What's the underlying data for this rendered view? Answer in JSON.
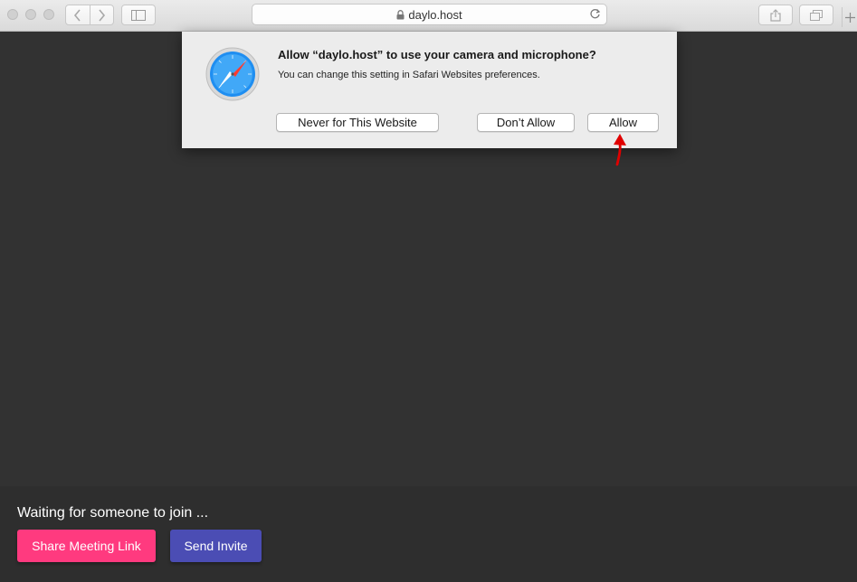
{
  "browser": {
    "address": "daylo.host",
    "icons": [
      "back-icon",
      "forward-icon",
      "sidebar-icon",
      "lock-icon",
      "reload-icon",
      "share-icon",
      "tabs-icon",
      "new-tab-icon"
    ]
  },
  "dialog": {
    "title": "Allow “daylo.host” to use your camera and microphone?",
    "subtitle": "You can change this setting in Safari Websites preferences.",
    "buttons": {
      "never": "Never for This Website",
      "dont_allow": "Don’t Allow",
      "allow": "Allow"
    },
    "icon": "safari-compass-icon"
  },
  "meeting": {
    "status": "Waiting for someone to join ...",
    "share_label": "Share Meeting Link",
    "invite_label": "Send Invite"
  },
  "colors": {
    "background": "#323232",
    "share_button": "#ff3a7f",
    "invite_button": "#4b4db4",
    "annotation_arrow": "#e00000"
  }
}
